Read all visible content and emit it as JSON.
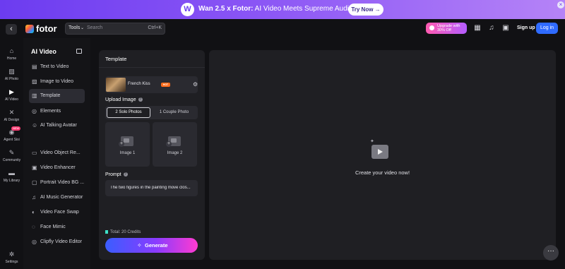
{
  "banner": {
    "title_bold": "Wan 2.5 x Fotor:",
    "title_rest": " AI Video Meets Supreme Audio",
    "cta": "Try Now →",
    "close": "×",
    "logo_glyph": "W"
  },
  "topbar": {
    "back_glyph": "‹",
    "logo": "fotor",
    "tools": "Tools",
    "search_placeholder": "Search",
    "shortcut": "Ctrl+K",
    "upgrade_line1": "Upgrade with",
    "upgrade_line2": "30% Off",
    "sign_up": "Sign up",
    "log_in": "Log in"
  },
  "rail": [
    {
      "label": "Home",
      "icon": "home-icon"
    },
    {
      "label": "AI Photo",
      "icon": "photo-icon"
    },
    {
      "label": "AI Video",
      "icon": "video-icon",
      "active": true
    },
    {
      "label": "AI Design",
      "icon": "design-icon"
    },
    {
      "label": "Agent Sisi",
      "icon": "agent-icon",
      "badge": "NEW"
    },
    {
      "label": "Community",
      "icon": "community-icon"
    },
    {
      "label": "My Library",
      "icon": "library-icon"
    },
    {
      "label": "Settings",
      "icon": "gear-icon"
    }
  ],
  "sidenav": {
    "title": "AI Video",
    "items": [
      {
        "label": "Text to Video",
        "icon": "text-icon"
      },
      {
        "label": "Image to Video",
        "icon": "image-icon"
      },
      {
        "label": "Template",
        "icon": "template-icon",
        "active": true
      },
      {
        "label": "Elements",
        "icon": "elements-icon"
      },
      {
        "label": "AI Talking Avatar",
        "icon": "avatar-icon"
      },
      {
        "label": "Video Object Re...",
        "icon": "eraser-icon"
      },
      {
        "label": "Video Enhancer",
        "icon": "enhance-icon"
      },
      {
        "label": "Portrait Video BG ...",
        "icon": "portrait-icon"
      },
      {
        "label": "AI Music Generator",
        "icon": "music-icon"
      },
      {
        "label": "Video Face Swap",
        "icon": "swap-icon"
      },
      {
        "label": "Face Mimic",
        "icon": "face-icon"
      },
      {
        "label": "Clipfly Video Editor",
        "icon": "clipfly-icon"
      }
    ]
  },
  "panel": {
    "title": "Template",
    "template_name": "French Kiss",
    "template_badge": "HOT",
    "upload_label": "Upload Image",
    "help": "?",
    "seg_active": "2 Solo Photos",
    "seg_other": "1 Couple Photo",
    "slot1": "Image 1",
    "slot2": "Image 2",
    "prompt_label": "Prompt",
    "prompt_text": "The two figures in the painting move clos...",
    "credits": "Total: 20 Credits",
    "generate": "Generate"
  },
  "preview": {
    "empty_text": "Create your video now!",
    "more": "···"
  },
  "colors": {
    "accent": "#2f6bff",
    "banner_start": "#6c3cf0",
    "generate_start": "#3a5dff",
    "generate_end": "#ff3bd0",
    "hot": "#ff6b1a"
  }
}
